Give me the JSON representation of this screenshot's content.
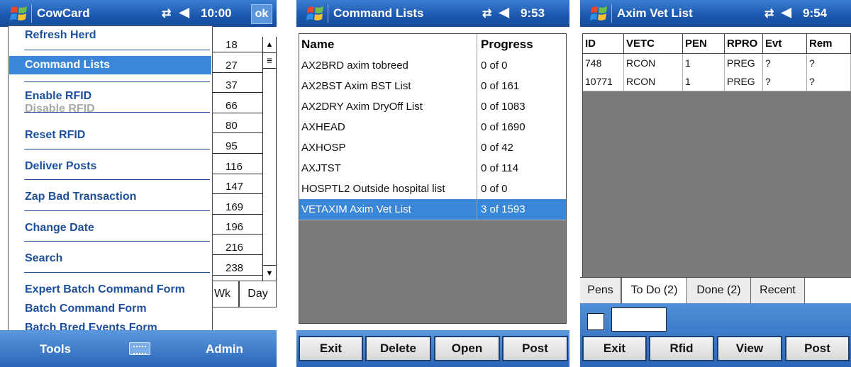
{
  "screen1": {
    "title": "CowCard",
    "clock": "10:00",
    "ok_label": "ok",
    "menu": [
      {
        "label": "Refresh Herd",
        "state": "normal"
      },
      {
        "label": "Command Lists",
        "state": "selected"
      },
      {
        "label": "Enable RFID",
        "state": "normal"
      },
      {
        "label": "Disable RFID",
        "state": "disabled"
      },
      {
        "label": "Reset RFID",
        "state": "normal"
      },
      {
        "label": "Deliver Posts",
        "state": "normal"
      },
      {
        "label": "Zap Bad Transaction",
        "state": "normal"
      },
      {
        "label": "Change Date",
        "state": "normal"
      },
      {
        "label": "Search",
        "state": "normal"
      },
      {
        "label": "Expert Batch Command Form",
        "state": "normal"
      },
      {
        "label": "Batch Command Form",
        "state": "normal"
      },
      {
        "label": "Batch Bred Events Form",
        "state": "normal"
      }
    ],
    "numbers": [
      "18",
      "27",
      "37",
      "66",
      "80",
      "95",
      "116",
      "147",
      "169",
      "196",
      "216",
      "238"
    ],
    "tabs": [
      "Wk",
      "Day"
    ],
    "toolbar": {
      "left": "Tools",
      "right": "Admin",
      "keyboard_icon": "keyboard-icon"
    }
  },
  "screen2": {
    "title": "Command Lists",
    "clock": "9:53",
    "columns": [
      "Name",
      "Progress"
    ],
    "rows": [
      {
        "name": "AX2BRD  axim tobreed",
        "progress": "0 of 0"
      },
      {
        "name": "AX2BST  Axim BST List",
        "progress": "0 of 161"
      },
      {
        "name": "AX2DRY  Axim DryOff List",
        "progress": "0 of 1083"
      },
      {
        "name": "AXHEAD",
        "progress": "0 of 1690"
      },
      {
        "name": "AXHOSP",
        "progress": "0 of 42"
      },
      {
        "name": "AXJTST",
        "progress": "0 of 114"
      },
      {
        "name": "HOSPTL2  Outside hospital list",
        "progress": "0 of 0"
      },
      {
        "name": "VETAXIM  Axim Vet List",
        "progress": "3 of 1593"
      }
    ],
    "selected_row": 7,
    "buttons": [
      "Exit",
      "Delete",
      "Open",
      "Post"
    ]
  },
  "screen3": {
    "title": "Axim Vet List",
    "clock": "9:54",
    "columns": [
      "ID",
      "VETC",
      "PEN",
      "RPRO",
      "Evt",
      "Rem"
    ],
    "rows": [
      [
        "748",
        "RCON",
        "1",
        "PREG",
        "?",
        "?"
      ],
      [
        "10771",
        "RCON",
        "1",
        "PREG",
        "?",
        "?"
      ]
    ],
    "tabs": [
      "Pens",
      "To Do (2)",
      "Done (2)",
      "Recent"
    ],
    "active_tab": 1,
    "buttons": [
      "Exit",
      "Rfid",
      "View",
      "Post"
    ]
  },
  "colors": {
    "title_blue": "#1c59b0",
    "selection_blue": "#3a86d8",
    "menu_text": "#1d4f9a",
    "list_bg": "#7a7a7a"
  }
}
